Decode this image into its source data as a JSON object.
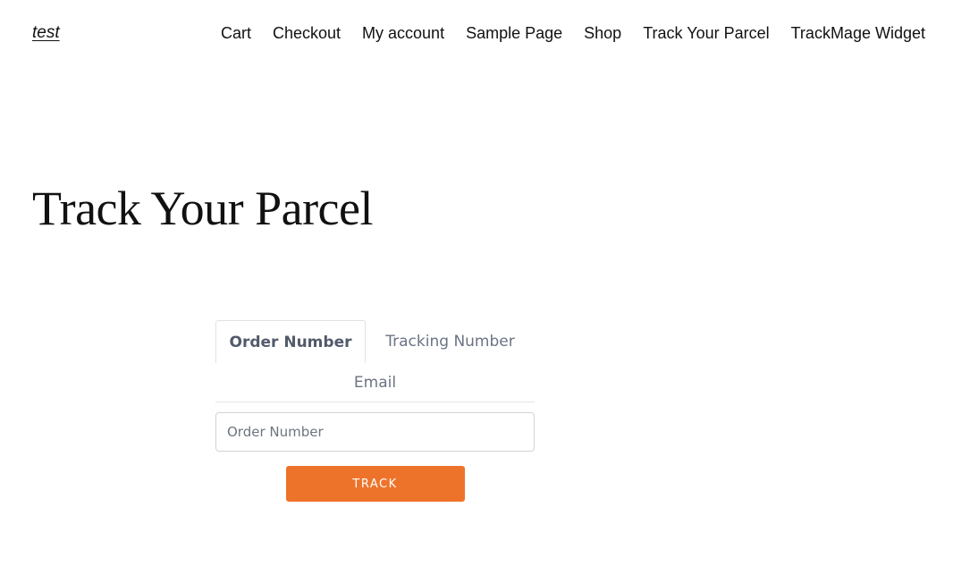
{
  "header": {
    "site_title": "test",
    "nav": [
      {
        "label": "Cart"
      },
      {
        "label": "Checkout"
      },
      {
        "label": "My account"
      },
      {
        "label": "Sample Page"
      },
      {
        "label": "Shop"
      },
      {
        "label": "Track Your Parcel"
      },
      {
        "label": "TrackMage Widget"
      }
    ]
  },
  "page": {
    "title": "Track Your Parcel"
  },
  "widget": {
    "tabs": [
      {
        "label": "Order Number",
        "active": true
      },
      {
        "label": "Tracking Number",
        "active": false
      },
      {
        "label": "Email",
        "active": false
      }
    ],
    "input": {
      "placeholder": "Order Number",
      "value": ""
    },
    "button_label": "TRACK",
    "accent_color": "#ee732a"
  }
}
